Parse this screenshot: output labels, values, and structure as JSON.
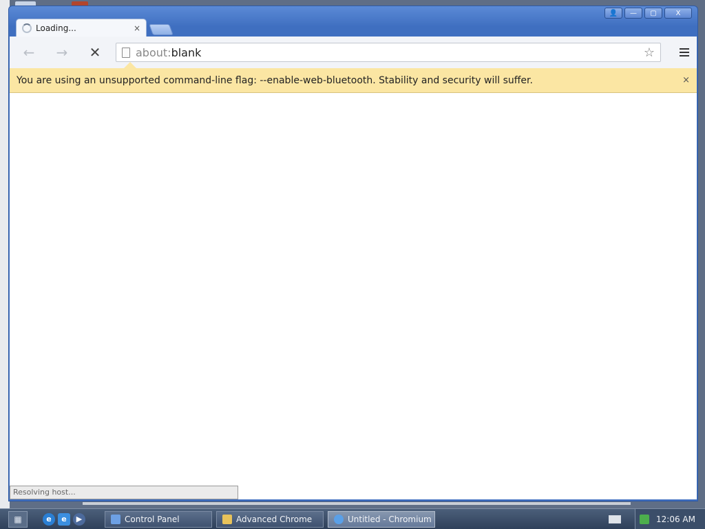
{
  "window": {
    "controls": [
      "👤",
      "—",
      "▢",
      "X"
    ]
  },
  "tab": {
    "title": "Loading...",
    "close": "×"
  },
  "toolbar": {
    "back": "←",
    "forward": "→",
    "stop": "✕",
    "url_scheme": "about:",
    "url_host": "blank",
    "star": "☆"
  },
  "infobar": {
    "message": "You are using an unsupported command-line flag: --enable-web-bluetooth. Stability and security will suffer.",
    "close": "×"
  },
  "status": {
    "text": "Resolving host..."
  },
  "taskbar": {
    "start": "▦",
    "quick_launch": [
      "e",
      "e",
      "▶"
    ],
    "tasks": [
      {
        "label": "Control Panel",
        "active": false
      },
      {
        "label": "Advanced Chrome",
        "active": false
      },
      {
        "label": "Untitled - Chromium",
        "active": true
      }
    ],
    "clock": "12:06 AM"
  },
  "colors": {
    "infobar_bg": "#fbe6a3",
    "window_frame": "#3f6fc0"
  }
}
